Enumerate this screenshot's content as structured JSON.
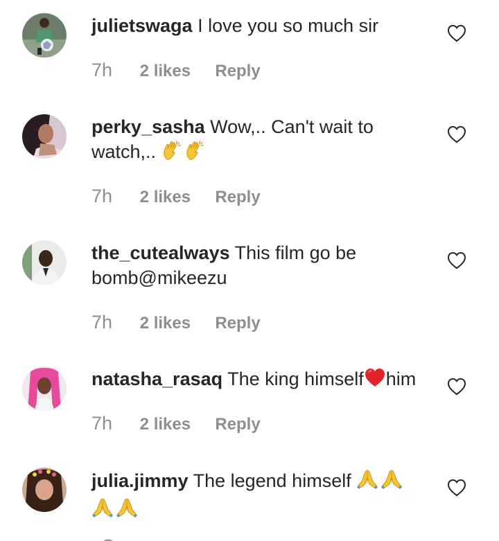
{
  "comments": [
    {
      "username": "julietswaga",
      "text": "I love you so much sir",
      "time": "7h",
      "likes": "2 likes",
      "reply": "Reply"
    },
    {
      "username": "perky_sasha",
      "text": "Wow,.. Can't wait to watch,..",
      "time": "7h",
      "likes": "2 likes",
      "reply": "Reply"
    },
    {
      "username": "the_cutealways",
      "text": "This film go be bomb@mikeezu",
      "time": "7h",
      "likes": "2 likes",
      "reply": "Reply"
    },
    {
      "username": "natasha_rasaq",
      "text_before": "The king himself",
      "text_after": "him",
      "time": "7h",
      "likes": "2 likes",
      "reply": "Reply"
    },
    {
      "username": "julia.jimmy",
      "text": "The legend himself",
      "time": "",
      "likes": "",
      "reply": ""
    }
  ],
  "icons": {
    "like": "heart-outline-icon",
    "clap_emoji": "clapping-hands-emoji",
    "heart_emoji": "red-heart-emoji",
    "pray_emoji": "folded-hands-emoji"
  },
  "colors": {
    "text": "#262626",
    "secondary": "#8e8e8e",
    "heart_emoji": "#e0252f",
    "clap_emoji": "#f7c531",
    "pray_emoji": "#f7c531"
  }
}
